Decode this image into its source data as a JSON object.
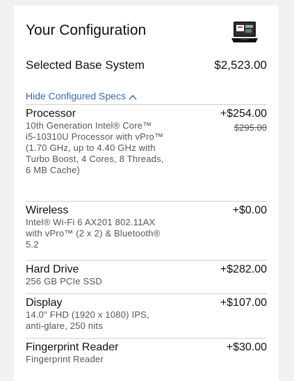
{
  "header": {
    "title": "Your Configuration",
    "product_image_icon": "laptop-icon"
  },
  "base_system": {
    "label": "Selected Base System",
    "price": "$2,523.00"
  },
  "toggle": {
    "label": "Hide Configured Specs",
    "icon": "chevron-up-icon"
  },
  "specs": [
    {
      "name": "Processor",
      "description": "10th Generation Intel® Core™ i5-10310U Processor with vPro™ (1.70 GHz, up to 4.40 GHz with Turbo Boost, 4 Cores, 8 Threads, 6 MB Cache)",
      "price": "+$254.00",
      "original_price": "295.00"
    },
    {
      "name": "Wireless",
      "description": "Intel® Wi-Fi 6 AX201 802.11AX with vPro™ (2 x 2) & Bluetooth® 5.2",
      "price": "+$0.00"
    },
    {
      "name": "Hard Drive",
      "description": "256 GB PCIe SSD",
      "price": "+$282.00"
    },
    {
      "name": "Display",
      "description": "14.0\" FHD (1920 x 1080) IPS, anti-glare, 250 nits",
      "price": "+$107.00"
    },
    {
      "name": "Fingerprint Reader",
      "description": "Fingerprint Reader",
      "price": "+$30.00"
    }
  ]
}
